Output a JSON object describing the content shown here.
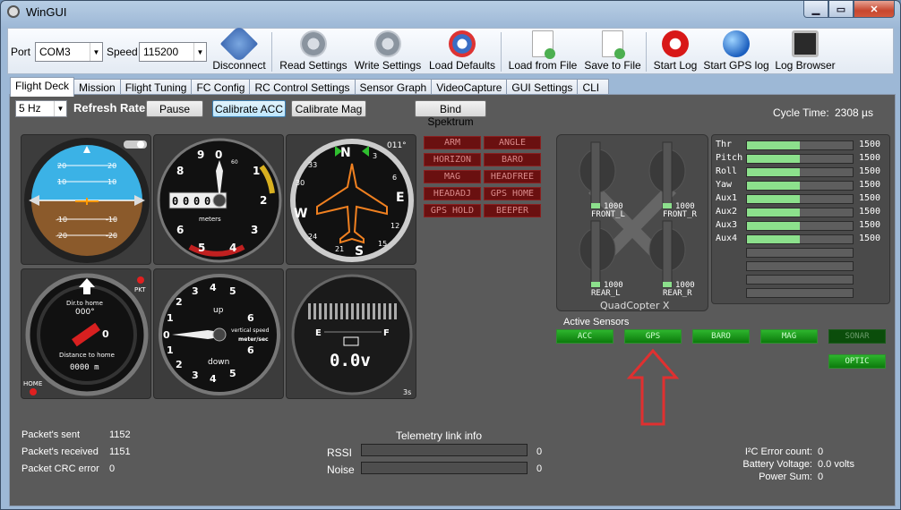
{
  "window": {
    "title": "WinGUI"
  },
  "toolbar": {
    "port_label": "Port",
    "port_value": "COM3",
    "speed_label": "Speed",
    "speed_value": "115200",
    "buttons": [
      {
        "label": "Disconnect"
      },
      {
        "label": "Read Settings"
      },
      {
        "label": "Write Settings"
      },
      {
        "label": "Load Defaults"
      },
      {
        "label": "Load from File"
      },
      {
        "label": "Save to File"
      },
      {
        "label": "Start Log"
      },
      {
        "label": "Start GPS log"
      },
      {
        "label": "Log Browser"
      }
    ]
  },
  "tabs": [
    {
      "label": "Flight Deck"
    },
    {
      "label": "Mission"
    },
    {
      "label": "Flight Tuning"
    },
    {
      "label": "FC Config"
    },
    {
      "label": "RC Control Settings"
    },
    {
      "label": "Sensor Graph"
    },
    {
      "label": "VideoCapture"
    },
    {
      "label": "GUI Settings"
    },
    {
      "label": "CLI"
    }
  ],
  "controls": {
    "rate_value": "5 Hz",
    "refresh_label": "Refresh Rate",
    "pause": "Pause",
    "calib_acc": "Calibrate ACC",
    "calib_mag": "Calibrate Mag",
    "bind": "Bind Spektrum",
    "cycle_label": "Cycle Time:",
    "cycle_value": "2308 µs"
  },
  "attitude": {
    "marks": [
      "20",
      "20",
      "10",
      "10",
      "-10",
      "-10",
      "-20",
      "-20"
    ]
  },
  "altimeter": {
    "digits": [
      "0",
      "0",
      "0",
      "0",
      "0"
    ],
    "unit": "meters",
    "numbers": [
      "0",
      "1",
      "2",
      "3",
      "4",
      "5",
      "6",
      "7",
      "8",
      "9"
    ],
    "small": "60"
  },
  "heading": {
    "value": "011°",
    "cardinals": [
      "N",
      "E",
      "S",
      "W"
    ],
    "ticks": [
      "33",
      "3",
      "6",
      "12",
      "15",
      "21",
      "24",
      "30"
    ]
  },
  "home": {
    "dir_label": "Dir.to home",
    "dir_value": "000°",
    "dist_label": "Distance to home",
    "dist_value": "0000  m",
    "sat": "0",
    "pkt": "PKT",
    "home": "HOME"
  },
  "vario": {
    "up": "up",
    "down": "down",
    "label1": "vertical speed",
    "label2": "meter/sec",
    "nums": [
      "0",
      "1",
      "2",
      "3",
      "4",
      "5",
      "6",
      "6",
      "5",
      "4",
      "3",
      "2",
      "1"
    ]
  },
  "battery": {
    "e": "E",
    "f": "F",
    "value": "0.0v",
    "time": "3s"
  },
  "modes": [
    "ARM",
    "ANGLE",
    "HORIZON",
    "BARO",
    "MAG",
    "HEADFREE",
    "HEADADJ",
    "GPS HOME",
    "GPS HOLD",
    "BEEPER"
  ],
  "motors": {
    "title": "QuadCopter X",
    "m": [
      {
        "name": "FRONT_L",
        "val": "1000"
      },
      {
        "name": "FRONT_R",
        "val": "1000"
      },
      {
        "name": "REAR_L",
        "val": "1000"
      },
      {
        "name": "REAR_R",
        "val": "1000"
      }
    ]
  },
  "rc": {
    "channels": [
      {
        "name": "Thr",
        "value": "1500",
        "fill": 0.5
      },
      {
        "name": "Pitch",
        "value": "1500",
        "fill": 0.5
      },
      {
        "name": "Roll",
        "value": "1500",
        "fill": 0.5
      },
      {
        "name": "Yaw",
        "value": "1500",
        "fill": 0.5
      },
      {
        "name": "Aux1",
        "value": "1500",
        "fill": 0.5
      },
      {
        "name": "Aux2",
        "value": "1500",
        "fill": 0.5
      },
      {
        "name": "Aux3",
        "value": "1500",
        "fill": 0.5
      },
      {
        "name": "Aux4",
        "value": "1500",
        "fill": 0.5
      },
      {
        "name": "",
        "value": "",
        "fill": 0
      },
      {
        "name": "",
        "value": "",
        "fill": 0
      },
      {
        "name": "",
        "value": "",
        "fill": 0
      },
      {
        "name": "",
        "value": "",
        "fill": 0
      }
    ]
  },
  "sensors": {
    "title": "Active Sensors",
    "items": [
      {
        "label": "ACC",
        "on": true
      },
      {
        "label": "GPS",
        "on": true
      },
      {
        "label": "BARO",
        "on": true
      },
      {
        "label": "MAG",
        "on": true
      },
      {
        "label": "SONAR",
        "on": false
      },
      {
        "label": "OPTIC",
        "on": true
      }
    ]
  },
  "stats": {
    "sent_label": "Packet's sent",
    "sent": "1152",
    "recv_label": "Packet's received",
    "recv": "1151",
    "crc_label": "Packet CRC error",
    "crc": "0"
  },
  "telemetry": {
    "title": "Telemetry link info",
    "rssi_label": "RSSI",
    "rssi": "0",
    "noise_label": "Noise",
    "noise": "0"
  },
  "i2c": {
    "err_label": "I²C Error count:",
    "err": "0",
    "batt_label": "Battery Voltage:",
    "batt": "0.0 volts",
    "power_label": "Power Sum:",
    "power": "0"
  },
  "colors": {
    "sensor_on": "#1fa31f",
    "mode_off": "#6a1010",
    "bar_fill": "#8ce08c",
    "sky": "#3bb2e6",
    "ground": "#8b5a2b",
    "arrow": "#e03030"
  }
}
